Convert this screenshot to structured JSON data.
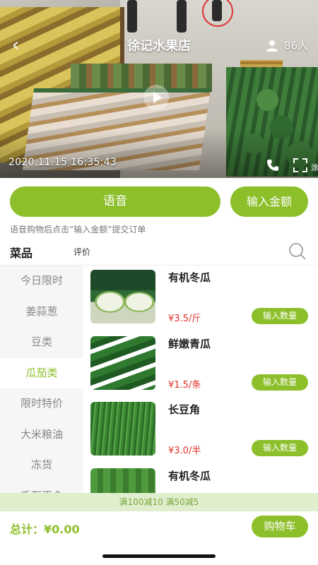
{
  "header": {
    "shop_name": "徐记水果店",
    "viewers": "86人",
    "timestamp": "2020.11.15   16:35:43",
    "edge_text": "涂"
  },
  "actions": {
    "voice_label": "语音",
    "amount_label": "输入金额",
    "hint": "语音购物后点击“输入金额”提交订单"
  },
  "tabs": {
    "dishes": "菜品",
    "reviews": "评价"
  },
  "sidebar": {
    "items": [
      {
        "label": "今日限时",
        "active": false
      },
      {
        "label": "姜蒜葱",
        "active": false
      },
      {
        "label": "豆类",
        "active": false
      },
      {
        "label": "瓜茄类",
        "active": true
      },
      {
        "label": "限时特价",
        "active": false
      },
      {
        "label": "大米粮油",
        "active": false
      },
      {
        "label": "冻货",
        "active": false
      },
      {
        "label": "千万不会",
        "active": false
      }
    ]
  },
  "products": [
    {
      "name": "有机冬瓜",
      "price": "¥3.5/斤",
      "button": "输入数量",
      "image": "winter-melon"
    },
    {
      "name": "鲜嫩青瓜",
      "price": "¥1.5/条",
      "button": "输入数量",
      "image": "cucumber"
    },
    {
      "name": "长豆角",
      "price": "¥3.0/半",
      "button": "输入数量",
      "image": "long-bean"
    },
    {
      "name": "有机冬瓜",
      "price": "",
      "button": "",
      "image": "winter-melon"
    }
  ],
  "promo": "满100减10   满50减5",
  "footer": {
    "total": "总计：¥0.00",
    "cart_label": "购物车"
  },
  "colors": {
    "accent": "#8cbf2a",
    "price": "#e0302a",
    "promo_bg": "#dfeecd"
  }
}
